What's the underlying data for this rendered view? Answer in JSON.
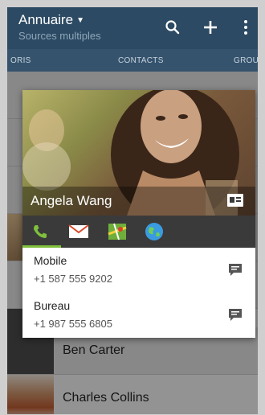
{
  "app_bar": {
    "title": "Annuaire",
    "subtitle": "Sources multiples",
    "icons": [
      "search-icon",
      "add-icon",
      "more-icon"
    ]
  },
  "tabs": [
    "ORIS",
    "CONTACTS",
    "GROU"
  ],
  "contact_card": {
    "name": "Angela Wang",
    "actions": [
      "phone-icon",
      "mail-icon",
      "map-icon",
      "web-icon"
    ],
    "numbers": [
      {
        "label": "Mobile",
        "number": "+1 587 555 9202"
      },
      {
        "label": "Bureau",
        "number": "+1 987 555 6805"
      }
    ]
  },
  "contacts_list": [
    {
      "name": "Ben Carter"
    },
    {
      "name": "Charles Collins"
    }
  ],
  "colors": {
    "app_bar": "#2c4a63",
    "accent": "#7fbf3c"
  }
}
